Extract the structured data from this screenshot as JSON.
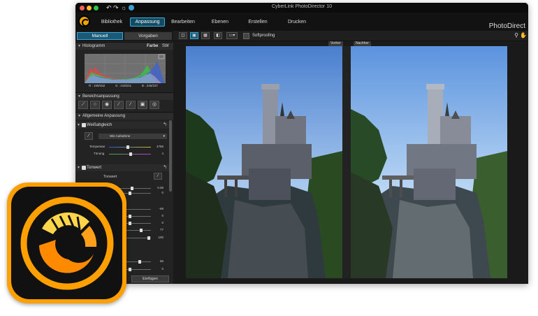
{
  "window": {
    "title": "CyberLink PhotoDirector 10",
    "brand": "PhotoDirect"
  },
  "nav": {
    "tabs": [
      "Bibliothek",
      "Anpassung",
      "Bearbeiten",
      "Ebenen",
      "Erstellen",
      "Drucken"
    ],
    "active": "Anpassung"
  },
  "modes": {
    "manual": "Manuell",
    "presets": "Vorgaben"
  },
  "histogram": {
    "title": "Histogramm",
    "color": "Farbe",
    "bw": "SW",
    "r": "R : 169/162",
    "g": "G : 218/211",
    "b": "B : 245/237"
  },
  "sections": {
    "region": "Bereichsanpassung",
    "general": "Allgemeine Anpassung"
  },
  "white_balance": {
    "title": "Weißabgleich",
    "preset": "Wie Aufnahme",
    "temperature_label": "Temperatur",
    "temperature_value": "4755",
    "temperature_level": 0.45,
    "tint_label": "Tönung",
    "tint_value": "4",
    "tint_level": 0.52
  },
  "tone": {
    "title": "Tonwert",
    "subtitle": "Tonwert",
    "values": [
      "0.06",
      "0",
      "-69",
      "0",
      "0",
      "77",
      "100",
      "66",
      "0"
    ],
    "levels": [
      0.55,
      0.5,
      0.3,
      0.5,
      0.5,
      0.78,
      0.98,
      0.75,
      0.5
    ]
  },
  "buttons": {
    "paste": "Einfügen"
  },
  "toolbar": {
    "softproof": "Softproofing"
  },
  "viewer": {
    "before": "Vorher",
    "after": "Nachher"
  },
  "colors": {
    "accent": "#3aa4d4",
    "icon_orange": "#ffa000"
  }
}
